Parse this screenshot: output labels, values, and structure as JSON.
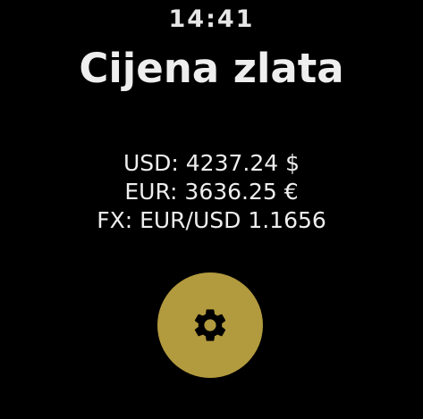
{
  "status_bar": {
    "time": "14:41"
  },
  "header": {
    "title": "Cijena zlata"
  },
  "prices": {
    "usd": "USD: 4237.24 $",
    "eur": "EUR: 3636.25 €",
    "fx": "FX: EUR/USD 1.1656"
  },
  "settings_button": {
    "icon": "gear-icon",
    "color": "#b29a3e"
  },
  "colors": {
    "background": "#000000",
    "text": "#eeeeee",
    "accent": "#b29a3e"
  }
}
